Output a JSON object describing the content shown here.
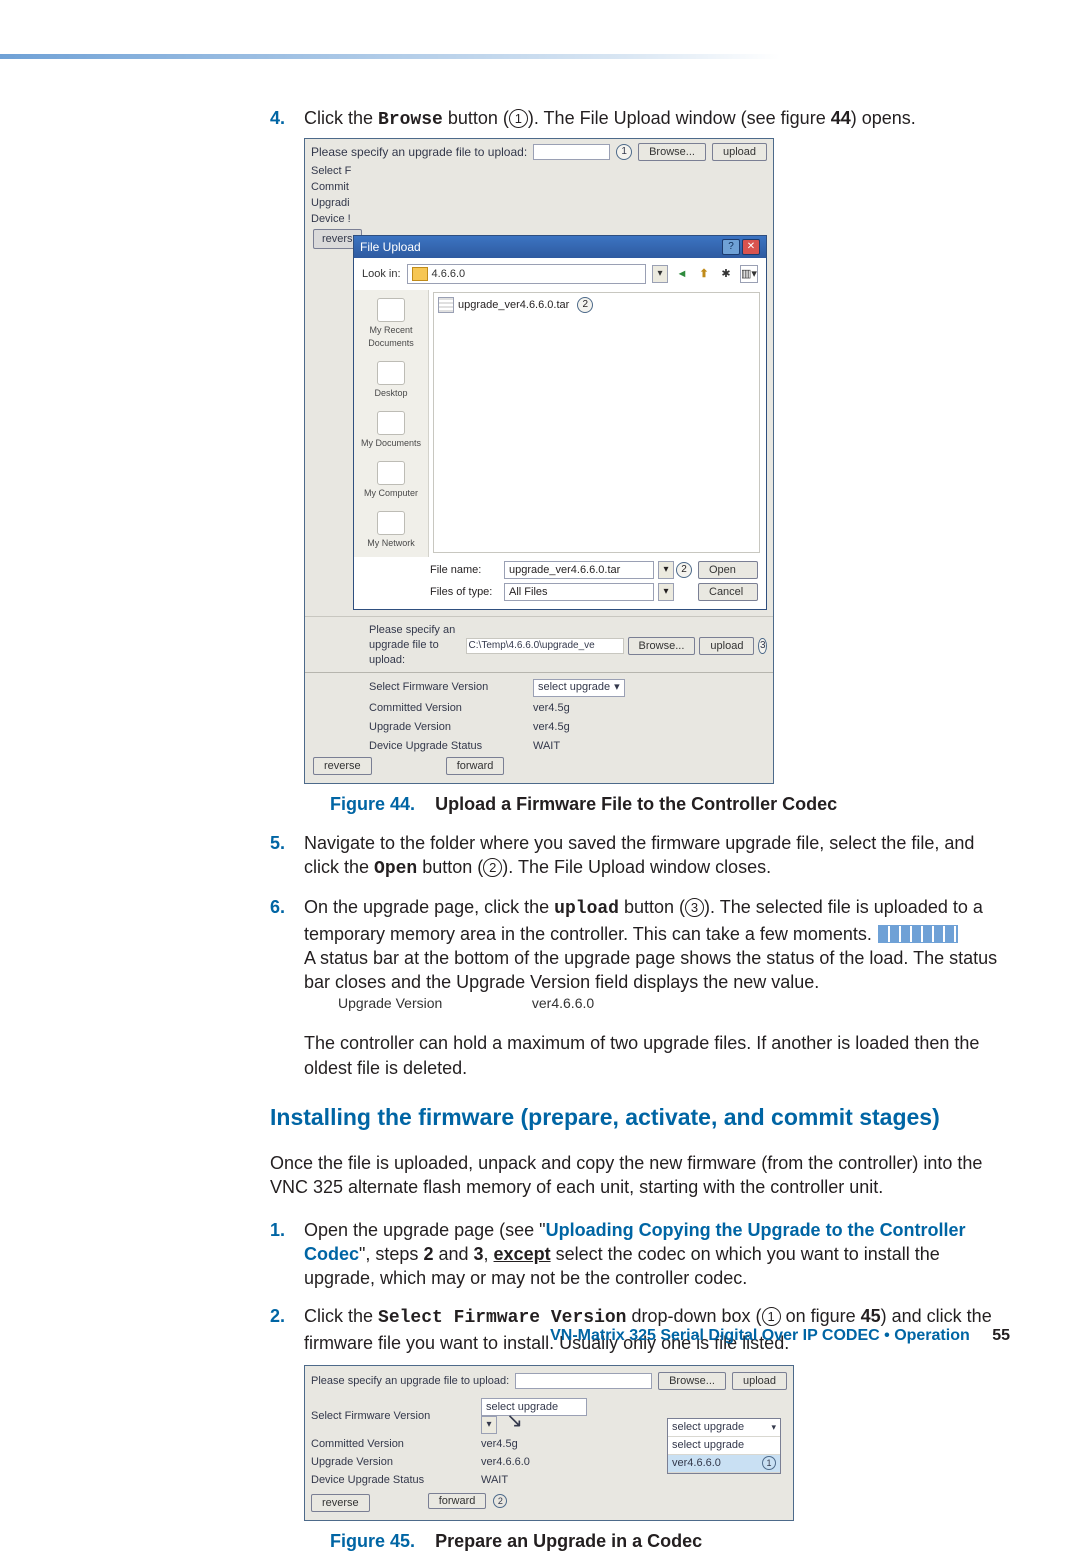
{
  "step4": {
    "num": "4.",
    "pre": "Click the ",
    "mono": "Browse",
    "post1": " button (",
    "circled": "1",
    "post2": "). The File Upload window (see figure ",
    "figref": "44",
    "post3": ") opens."
  },
  "fig44": {
    "topPrompt": "Please specify an upgrade file to upload:",
    "marker1": "1",
    "browseBtn": "Browse...",
    "uploadBtn": "upload",
    "leftLabels": {
      "l1": "Select F",
      "l2": "Commit",
      "l3": "Upgradi",
      "l4": "Device !"
    },
    "reverseBtnTop": "revers",
    "dialog": {
      "title": "File Upload",
      "help": "?",
      "close": "✕",
      "lookInLabel": "Look in:",
      "lookInValue": "4.6.6.0",
      "fileItem": "upgrade_ver4.6.6.0.tar",
      "marker2": "2",
      "places": {
        "p1": "My Recent Documents",
        "p2": "Desktop",
        "p3": "My Documents",
        "p4": "My Computer",
        "p5": "My Network"
      },
      "fileNameLabel": "File name:",
      "fileNameValue": "upgrade_ver4.6.6.0.tar",
      "fileTypeLabel": "Files of type:",
      "fileTypeValue": "All Files",
      "marker2b": "2",
      "openBtn": "Open",
      "cancelBtn": "Cancel"
    },
    "uplRow": {
      "prompt": "Please specify an upgrade file to upload:",
      "path": "C:\\Temp\\4.6.6.0\\upgrade_ve",
      "browse": "Browse...",
      "upload": "upload",
      "marker3": "3"
    },
    "lowPanel": {
      "selFirmLabel": "Select Firmware Version",
      "selFirmValue": "select upgrade",
      "committedLabel": "Committed Version",
      "committedValue": "ver4.5g",
      "upgradeLabel": "Upgrade Version",
      "upgradeValue": "ver4.5g",
      "statusLabel": "Device Upgrade Status",
      "statusValue": "WAIT",
      "reverse": "reverse",
      "forward": "forward"
    },
    "caption": {
      "lead": "Figure 44.",
      "ttl": "Upload a Firmware File to the Controller Codec"
    }
  },
  "step5": {
    "num": "5.",
    "text1": "Navigate to the folder where you saved the firmware upgrade file, select the file, and click the ",
    "mono": "Open",
    "text2": " button (",
    "circled": "2",
    "text3": "). The File Upload window closes."
  },
  "step6": {
    "num": "6.",
    "t1": "On the upgrade page, click the ",
    "mono": "upload",
    "t2": " button (",
    "circled": "3",
    "t3": "). The selected file is uploaded to a temporary memory area in the controller. This can take a few moments.",
    "t4": "A status bar at the bottom of the upgrade page shows the status of the load. The status bar closes and the Upgrade Version field displays the new value.",
    "inlineVers": {
      "label": "Upgrade Version",
      "value": "ver4.6.6.0"
    }
  },
  "para6b": "The controller can hold a maximum of two upgrade files. If another is loaded then the oldest file is deleted.",
  "sectionHeading": "Installing the firmware (prepare, activate, and commit stages)",
  "para7": "Once the file is uploaded, unpack and copy the new firmware (from the controller) into the VNC 325 alternate flash memory of each unit, starting with the controller unit.",
  "stepB1": {
    "num": "1.",
    "t1": "Open the upgrade page (see \"",
    "link": "Uploading Copying the Upgrade to the Controller Codec",
    "t2": "\", steps ",
    "b2": "2",
    "t3": " and ",
    "b3": "3",
    "t4": ", ",
    "except": "except",
    "t5": " select the codec on which you want to install the upgrade, which may or may not be the controller codec."
  },
  "stepB2": {
    "num": "2.",
    "t1": "Click the ",
    "mono": "Select Firmware Version",
    "t2": " drop-down box (",
    "circled": "1",
    "t3": " on figure ",
    "figref": "45",
    "t4": ") and click the firmware file you want to install. Usually only one is file listed."
  },
  "fig45": {
    "topPrompt": "Please specify an upgrade file to upload:",
    "browseBtn": "Browse...",
    "uploadBtn": "upload",
    "selFirmLabel": "Select Firmware Version",
    "selFirmValue": "select upgrade",
    "committedLabel": "Committed Version",
    "committedValue": "ver4.5g",
    "upgradeLabel": "Upgrade Version",
    "upgradeValue": "ver4.6.6.0",
    "statusLabel": "Device Upgrade Status",
    "statusValue": "WAIT",
    "reverse": "reverse",
    "forward": "forward",
    "popup": {
      "row1": "select upgrade",
      "row2a": "select upgrade",
      "row3": "ver4.6.6.0",
      "marker1": "1"
    },
    "marker2": "2",
    "caption": {
      "lead": "Figure 45.",
      "ttl": "Prepare an Upgrade in a Codec"
    }
  },
  "footer": {
    "text": "VN-Matrix 325 Serial Digital Over IP CODEC • Operation",
    "page": "55"
  }
}
